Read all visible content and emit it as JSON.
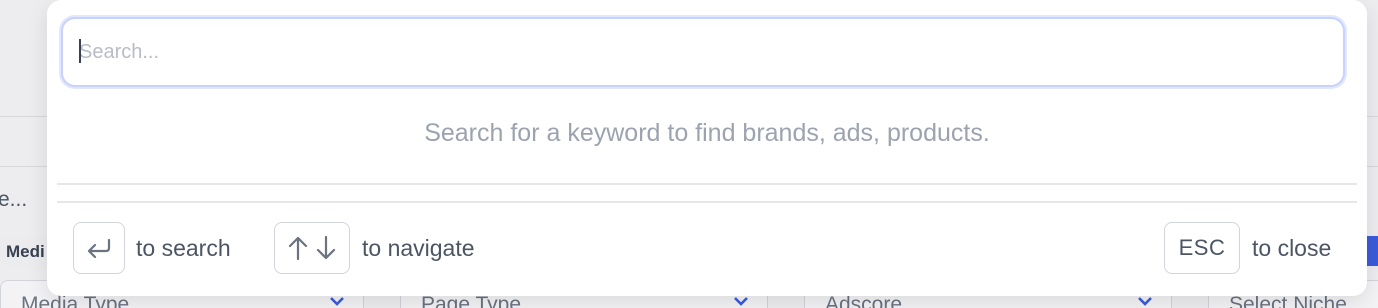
{
  "background": {
    "truncated_text": "e...",
    "media_chip_label": "Medi",
    "selects": [
      {
        "placeholder": "Media Type"
      },
      {
        "placeholder": "Page Type"
      },
      {
        "placeholder": "Adscore"
      },
      {
        "placeholder": "Select Niche"
      }
    ]
  },
  "search": {
    "placeholder": "Search...",
    "hint": "Search for a keyword to find brands, ads, products."
  },
  "footer": {
    "enter_label": "to search",
    "navigate_label": "to navigate",
    "esc_key": "ESC",
    "close_label": "to close"
  },
  "colors": {
    "accent_ring": "#c7d2fe",
    "hint_text": "#9ca3af",
    "background_chip_blue": "#3b5bdb"
  },
  "icons": {
    "enter": "return-arrow-icon",
    "up": "arrow-up-icon",
    "down": "arrow-down-icon",
    "chevron": "chevron-down-icon"
  }
}
